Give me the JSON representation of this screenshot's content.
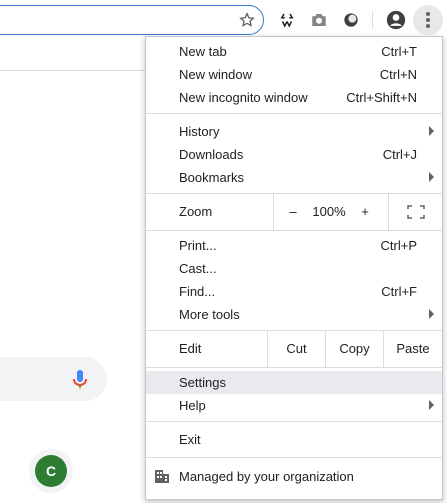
{
  "toolbar": {
    "icons": [
      "star-icon",
      "recycle-extension-icon",
      "camera-extension-icon",
      "circle-extension-icon",
      "profile-icon",
      "kebab-menu-icon"
    ]
  },
  "page": {
    "avatar_letter": "C"
  },
  "menu": {
    "new_tab": {
      "label": "New tab",
      "shortcut": "Ctrl+T"
    },
    "new_window": {
      "label": "New window",
      "shortcut": "Ctrl+N"
    },
    "new_incognito": {
      "label": "New incognito window",
      "shortcut": "Ctrl+Shift+N"
    },
    "history": {
      "label": "History"
    },
    "downloads": {
      "label": "Downloads",
      "shortcut": "Ctrl+J"
    },
    "bookmarks": {
      "label": "Bookmarks"
    },
    "zoom": {
      "label": "Zoom",
      "minus": "–",
      "value": "100%",
      "plus": "+"
    },
    "print": {
      "label": "Print...",
      "shortcut": "Ctrl+P"
    },
    "cast": {
      "label": "Cast..."
    },
    "find": {
      "label": "Find...",
      "shortcut": "Ctrl+F"
    },
    "more_tools": {
      "label": "More tools"
    },
    "edit": {
      "label": "Edit",
      "cut": "Cut",
      "copy": "Copy",
      "paste": "Paste"
    },
    "settings": {
      "label": "Settings"
    },
    "help": {
      "label": "Help"
    },
    "exit": {
      "label": "Exit"
    },
    "managed": {
      "label": "Managed by your organization"
    }
  },
  "colors": {
    "accent": "#1a73e8",
    "highlight": "#e8eaed",
    "avatar": "#2e7d32"
  }
}
